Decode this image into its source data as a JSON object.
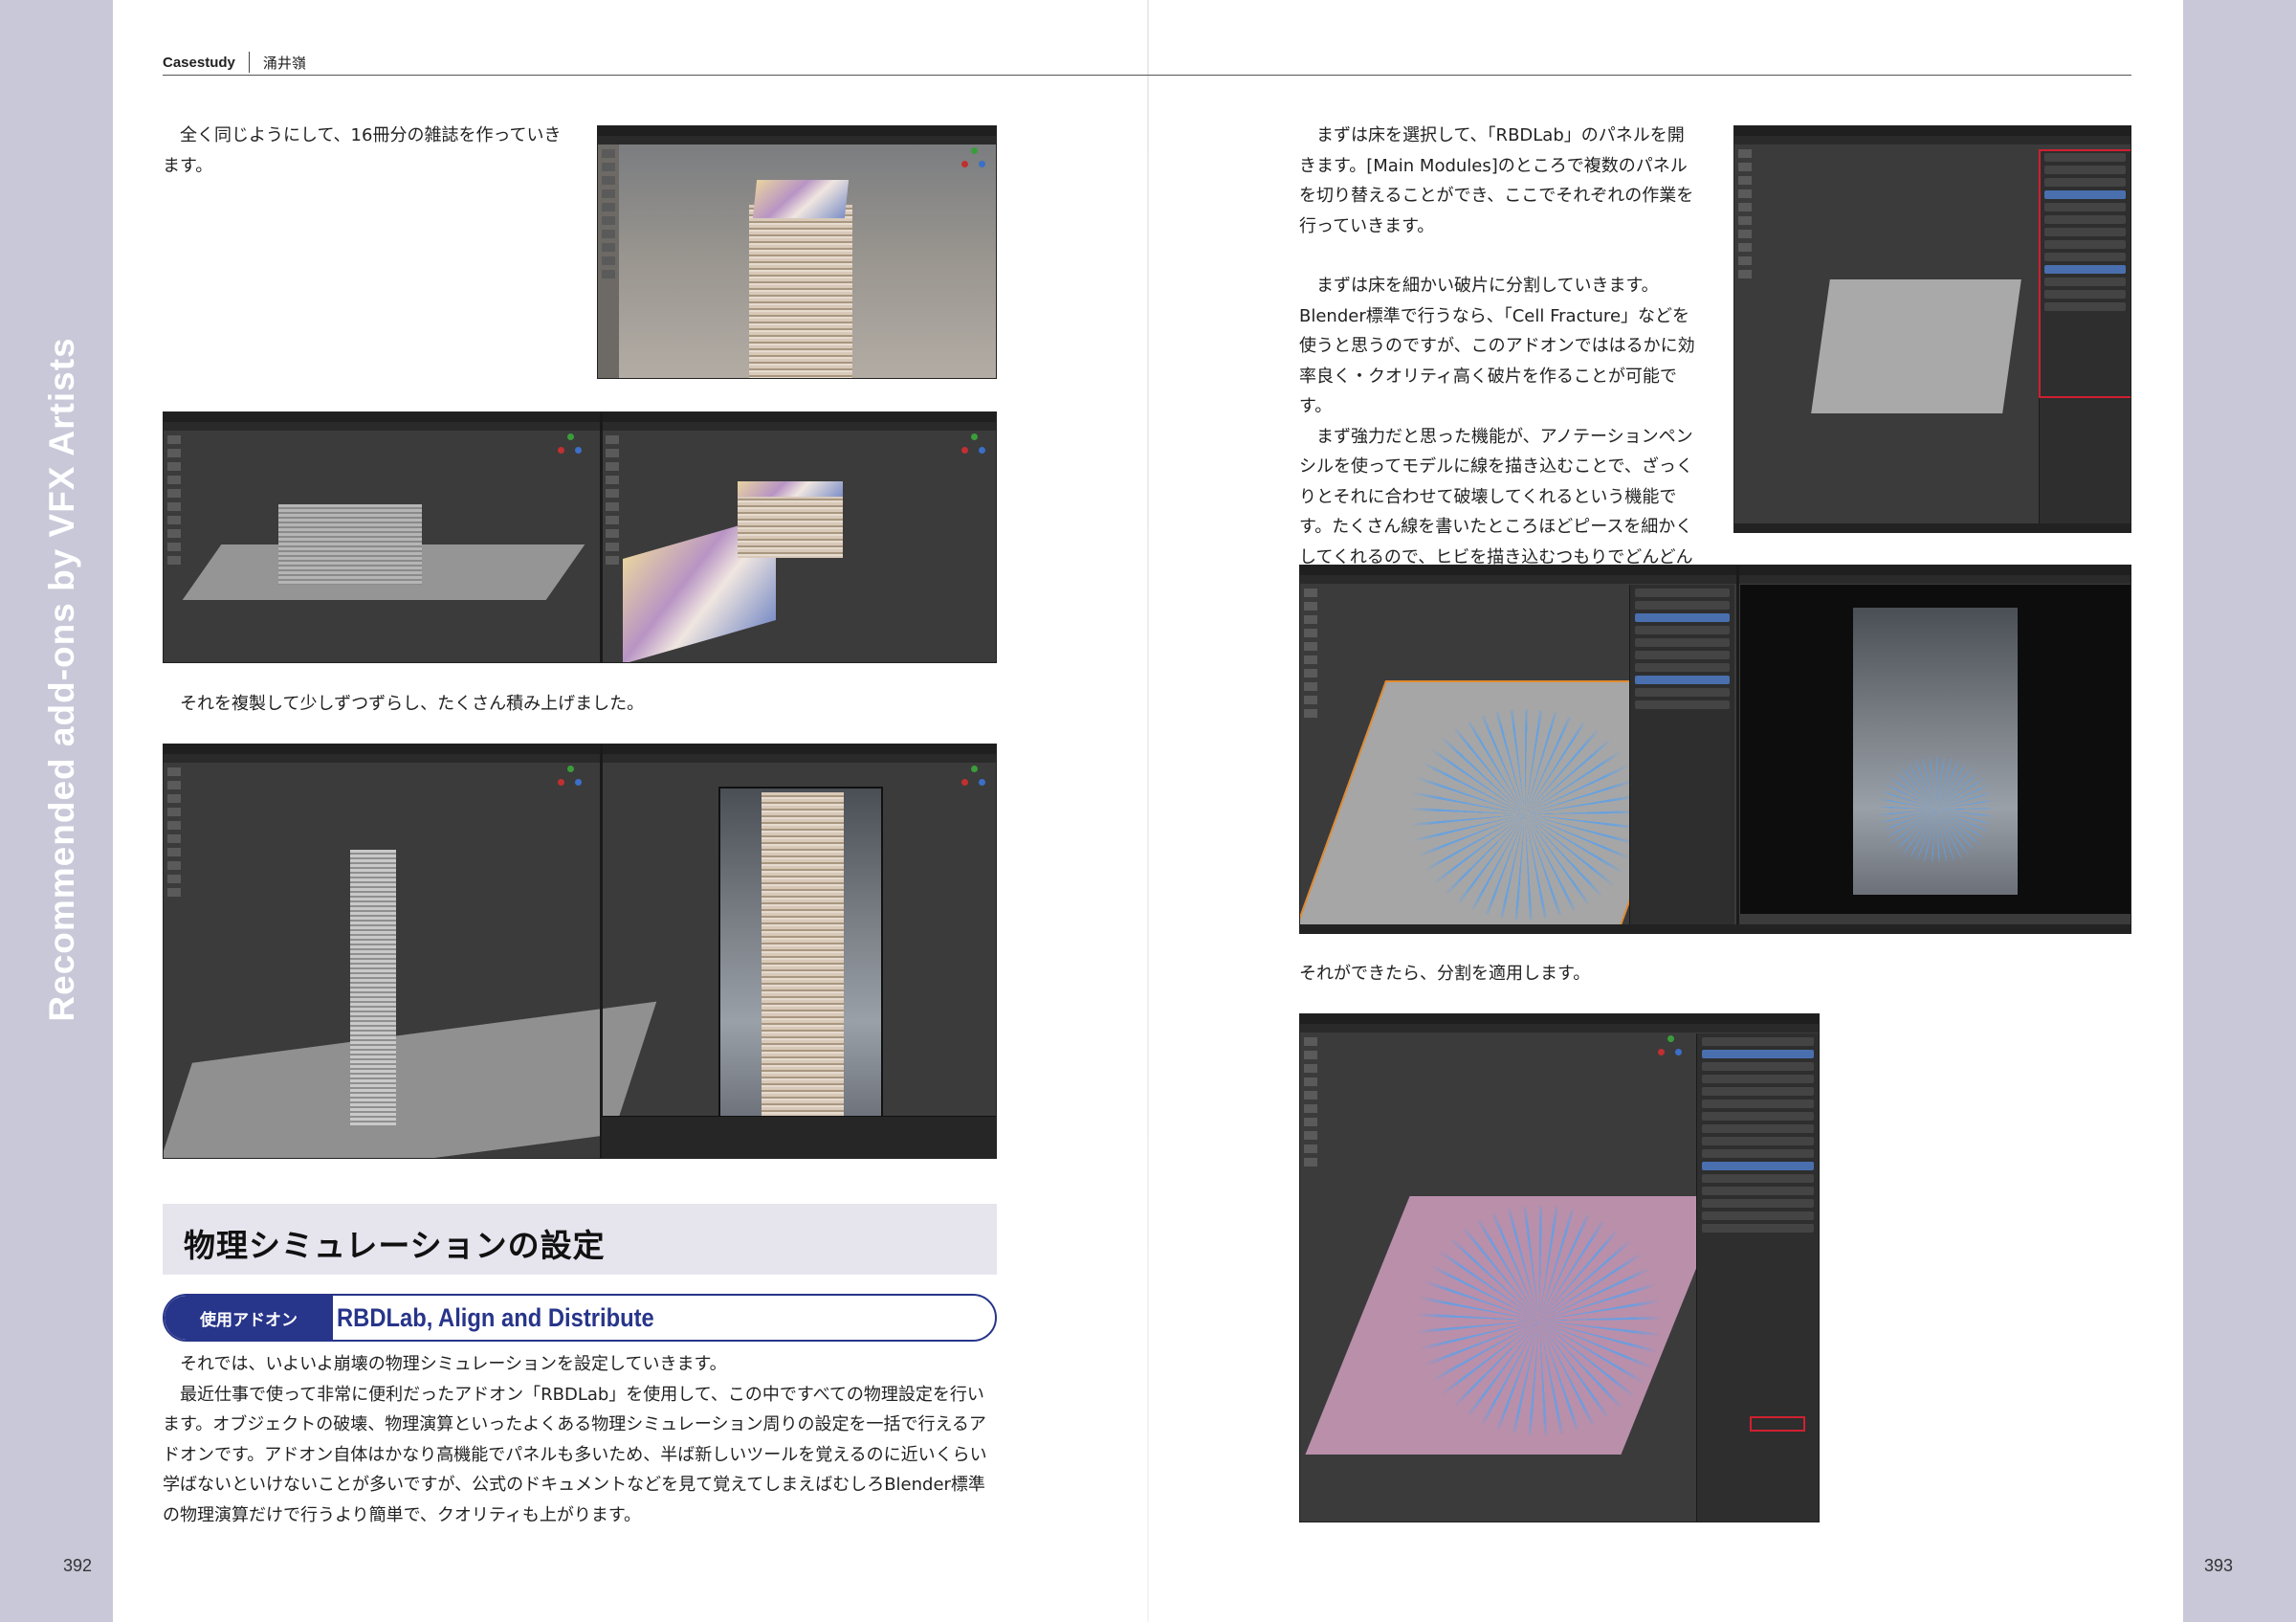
{
  "header": {
    "section": "Casestudy",
    "author": "涌井嶺"
  },
  "sidebar": {
    "vertical_title": "Recommended add-ons by VFX Artists"
  },
  "page_numbers": {
    "left": "392",
    "right": "393"
  },
  "left_page": {
    "para1": "全く同じようにして、16冊分の雑誌を作っていきます。",
    "para2": "それを複製して少しずつずらし、たくさん積み上げました。",
    "section_title": "物理シミュレーションの設定",
    "addon_label": "使用アドオン",
    "addon_name": "RBDLab, Align and Distribute",
    "para3": "それでは、いよいよ崩壊の物理シミュレーションを設定していきます。",
    "para4": "最近仕事で使って非常に便利だったアドオン「RBDLab」を使用して、この中ですべての物理設定を行います。オブジェクトの破壊、物理演算といったよくある物理シミュレーション周りの設定を一括で行えるアドオンです。アドオン自体はかなり高機能でパネルも多いため、半ば新しいツールを覚えるのに近いくらい学ばないといけないことが多いですが、公式のドキュメントなどを見て覚えてしまえばむしろBlender標準の物理演算だけで行うより簡単で、クオリティも上がります。"
  },
  "right_page": {
    "para1": "まずは床を選択して、「RBDLab」のパネルを開きます。[Main Modules]のところで複数のパネルを切り替えることができ、ここでそれぞれの作業を行っていきます。",
    "para2": "まずは床を細かい破片に分割していきます。Blender標準で行うなら、「Cell Fracture」などを使うと思うのですが、このアドオンでははるかに効率良く・クオリティ高く破片を作ることが可能です。",
    "para3": "まず強力だと思った機能が、アノテーションペンシルを使ってモデルに線を描き込むことで、ざっくりとそれに合わせて破壊してくれるという機能です。たくさん線を書いたところほどピースを細かくしてくれるので、ヒビを描き込むつもりでどんどん描いていきます。",
    "para4": "それができたら、分割を適用します。"
  }
}
